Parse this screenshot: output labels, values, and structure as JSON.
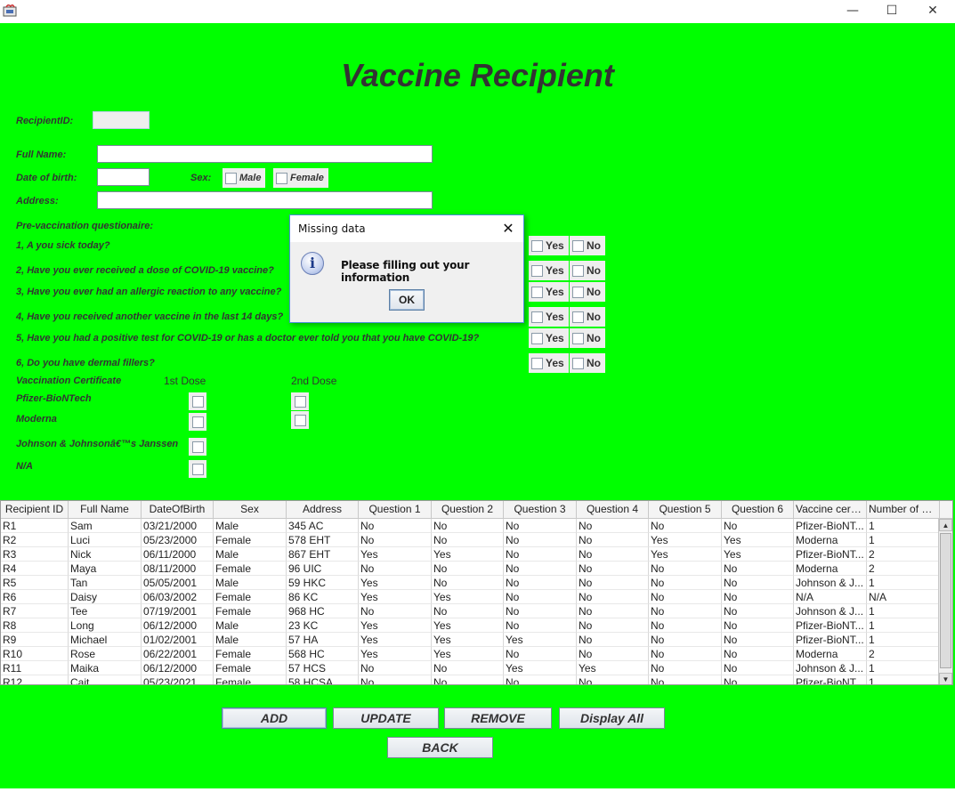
{
  "window": {
    "minimize_glyph": "—",
    "maximize_glyph": "☐",
    "close_glyph": "✕"
  },
  "form": {
    "heading": "Vaccine Recipient",
    "recipient_id_label": "RecipientID:",
    "recipient_id_value": "",
    "full_name_label": "Full Name:",
    "full_name_value": "",
    "dob_label": "Date of birth:",
    "dob_value": "",
    "sex_label": "Sex:",
    "sex_male": "Male",
    "sex_female": "Female",
    "address_label": "Address:",
    "address_value": "",
    "questionnaire_label": "Pre-vaccination questionaire:",
    "questions": [
      "1, A you sick today?",
      "2, Have you ever received a dose of COVID-19 vaccine?",
      "3, Have you ever had an allergic reaction to any vaccine?",
      "4, Have you received another vaccine in the last 14 days?",
      "5, Have you had a positive test for COVID-19 or has a doctor ever told you that you have COVID-19?",
      "6, Do you have dermal fillers?"
    ],
    "yes_label": "Yes",
    "no_label": "No",
    "certificate_label": "Vaccination Certificate",
    "dose1_label": "1st Dose",
    "dose2_label": "2nd Dose",
    "vaccines": [
      "Pfizer-BioNTech",
      "Moderna",
      "Johnson & Johnsonâ€™s Janssen",
      "N/A"
    ]
  },
  "table": {
    "columns": [
      "Recipient ID",
      "Full Name",
      "DateOfBirth",
      "Sex",
      "Address",
      "Question 1",
      "Question 2",
      "Question 3",
      "Question 4",
      "Question 5",
      "Question 6",
      "Vaccine certi...",
      "Number of D..."
    ],
    "rows": [
      [
        "R1",
        "Sam",
        "03/21/2000",
        "Male",
        "345 AC",
        "No",
        "No",
        "No",
        "No",
        "No",
        "No",
        "Pfizer-BioNT...",
        "1"
      ],
      [
        "R2",
        "Luci",
        "05/23/2000",
        "Female",
        "578 EHT",
        "No",
        "No",
        "No",
        "No",
        "Yes",
        "Yes",
        "Moderna",
        "1"
      ],
      [
        "R3",
        "Nick",
        "06/11/2000",
        "Male",
        "867 EHT",
        "Yes",
        "Yes",
        "No",
        "No",
        "Yes",
        "Yes",
        "Pfizer-BioNT...",
        "2"
      ],
      [
        "R4",
        "Maya",
        "08/11/2000",
        "Female",
        "96 UIC",
        "No",
        "No",
        "No",
        "No",
        "No",
        "No",
        "Moderna",
        "2"
      ],
      [
        "R5",
        "Tan",
        "05/05/2001",
        "Male",
        "59 HKC",
        "Yes",
        "No",
        "No",
        "No",
        "No",
        "No",
        "Johnson & J...",
        "1"
      ],
      [
        "R6",
        "Daisy",
        "06/03/2002",
        "Female",
        "86 KC",
        "Yes",
        "Yes",
        "No",
        "No",
        "No",
        "No",
        "N/A",
        "N/A"
      ],
      [
        "R7",
        "Tee",
        "07/19/2001",
        "Female",
        "968 HC",
        "No",
        "No",
        "No",
        "No",
        "No",
        "No",
        "Johnson & J...",
        "1"
      ],
      [
        "R8",
        "Long",
        "06/12/2000",
        "Male",
        " 23 KC",
        "Yes",
        "Yes",
        "No",
        "No",
        "No",
        "No",
        "Pfizer-BioNT...",
        "1"
      ],
      [
        "R9",
        "Michael",
        "01/02/2001",
        "Male",
        "57 HA",
        "Yes",
        "Yes",
        "Yes",
        "No",
        "No",
        "No",
        "Pfizer-BioNT...",
        "1"
      ],
      [
        "R10",
        "Rose",
        "06/22/2001",
        "Female",
        "568 HC",
        "Yes",
        "Yes",
        "No",
        "No",
        "No",
        "No",
        "Moderna",
        "2"
      ],
      [
        "R11",
        "Maika",
        "06/12/2000",
        "Female",
        "57 HCS",
        "No",
        "No",
        "Yes",
        "Yes",
        "No",
        "No",
        "Johnson & J...",
        "1"
      ],
      [
        "R12",
        "Cait",
        "05/23/2021",
        "Female",
        "58 HCSA",
        "No",
        "No",
        "No",
        "No",
        "No",
        "No",
        "Pfizer-BioNT...",
        "1"
      ]
    ]
  },
  "buttons": {
    "add": "ADD",
    "update": "UPDATE",
    "remove": "REMOVE",
    "display_all": "Display All",
    "back": "BACK"
  },
  "dialog": {
    "title": "Missing data",
    "message": "Please filling out your information",
    "ok": "OK",
    "close_glyph": "✕",
    "icon_glyph": "i"
  },
  "colors": {
    "background": "#00ff00",
    "heading": "#333333"
  }
}
